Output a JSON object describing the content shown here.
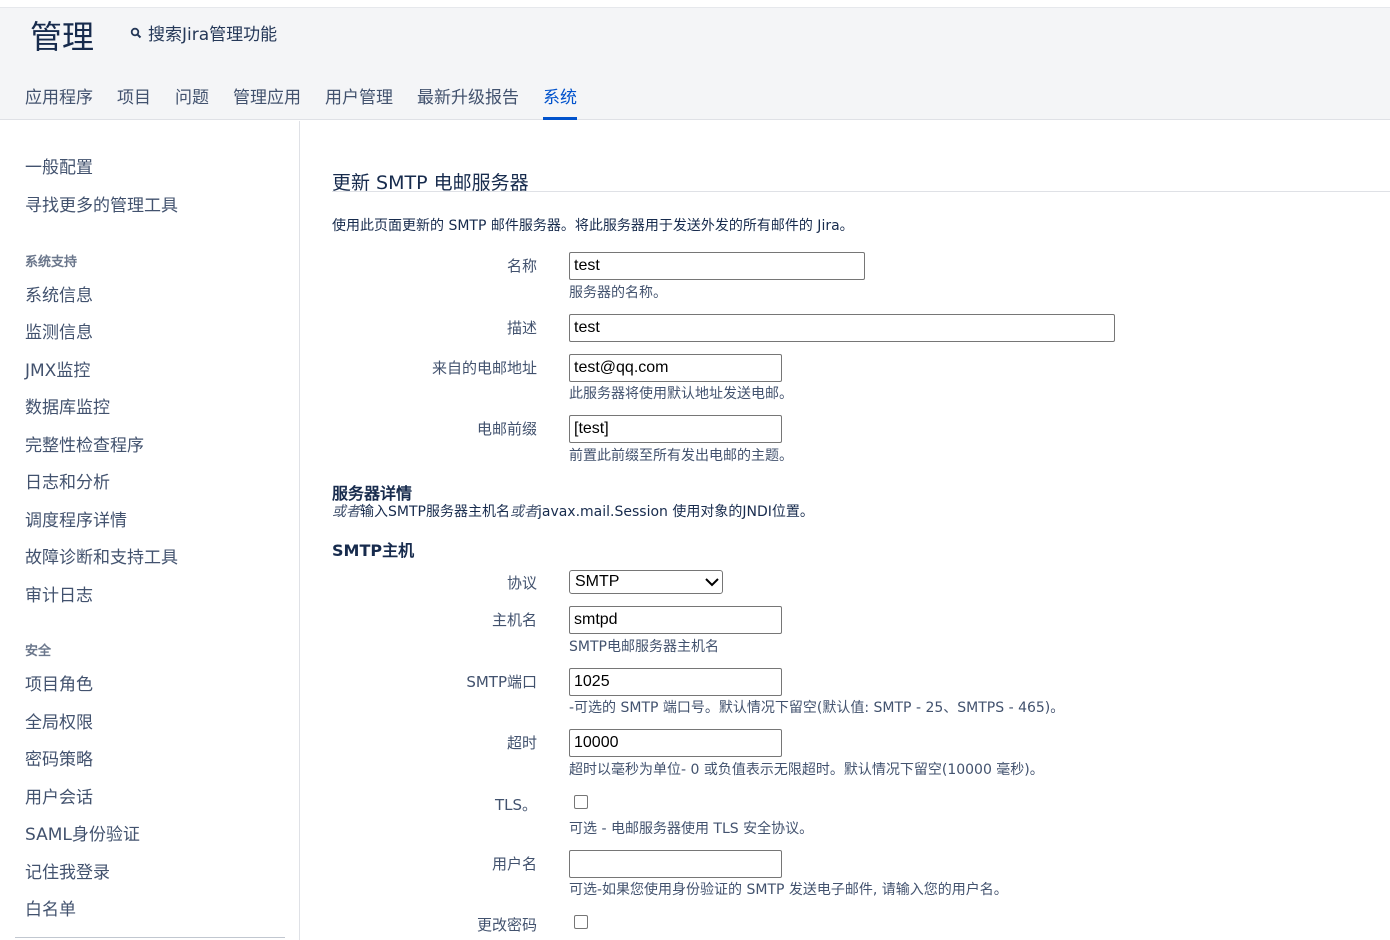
{
  "header": {
    "title": "管理",
    "search_label": "搜索Jira管理功能",
    "tabs": [
      {
        "label": "应用程序"
      },
      {
        "label": "项目"
      },
      {
        "label": "问题"
      },
      {
        "label": "管理应用"
      },
      {
        "label": "用户管理"
      },
      {
        "label": "最新升级报告"
      },
      {
        "label": "系统",
        "active": true
      }
    ]
  },
  "sidebar": {
    "top_items": [
      "一般配置",
      "寻找更多的管理工具"
    ],
    "section_support": {
      "heading": "系统支持",
      "items": [
        "系统信息",
        "监测信息",
        "JMX监控",
        "数据库监控",
        "完整性检查程序",
        "日志和分析",
        "调度程序详情",
        "故障诊断和支持工具",
        "审计日志"
      ]
    },
    "section_security": {
      "heading": "安全",
      "items": [
        "项目角色",
        "全局权限",
        "密码策略",
        "用户会话",
        "SAML身份验证",
        "记住我登录",
        "白名单"
      ]
    }
  },
  "main": {
    "heading": "更新 SMTP 电邮服务器",
    "intro": "使用此页面更新的 SMTP 邮件服务器。将此服务器用于发送外发的所有邮件的 Jira。",
    "name": {
      "label": "名称",
      "value": "test",
      "desc": "服务器的名称。"
    },
    "description": {
      "label": "描述",
      "value": "test"
    },
    "from": {
      "label": "来自的电邮地址",
      "value": "test@qq.com",
      "desc": "此服务器将使用默认地址发送电邮。"
    },
    "prefix": {
      "label": "电邮前缀",
      "value": "[test]",
      "desc": "前置此前缀至所有发出电邮的主题。"
    },
    "server_details": {
      "heading": "服务器详情",
      "or1": "或者",
      "text1": "输入SMTP服务器主机名",
      "or2": "或者",
      "text2": "javax.mail.Session 使用对象的JNDI位置。"
    },
    "smtp_host_heading": "SMTP主机",
    "protocol": {
      "label": "协议",
      "value": "SMTP"
    },
    "hostname": {
      "label": "主机名",
      "value": "smtpd",
      "desc": "SMTP电邮服务器主机名"
    },
    "port": {
      "label": "SMTP端口",
      "value": "1025",
      "desc": "-可选的 SMTP 端口号。默认情况下留空(默认值: SMTP - 25、SMTPS - 465)。"
    },
    "timeout": {
      "label": "超时",
      "value": "10000",
      "desc": "超时以毫秒为单位- 0 或负值表示无限超时。默认情况下留空(10000 毫秒)。"
    },
    "tls": {
      "label": "TLS。",
      "checked": false,
      "desc": "可选 - 电邮服务器使用 TLS 安全协议。"
    },
    "username": {
      "label": "用户名",
      "value": "",
      "desc": "可选-如果您使用身份验证的 SMTP 发送电子邮件, 请输入您的用户名。"
    },
    "change_password": {
      "label": "更改密码",
      "checked": false
    }
  }
}
